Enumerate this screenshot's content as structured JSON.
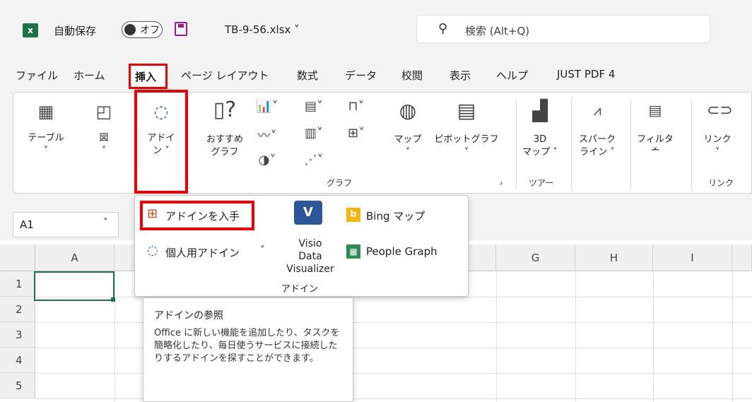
{
  "titlebar": {
    "autosave_label": "自動保存",
    "toggle_text": "オフ",
    "filename": "TB-9-56.xlsx ˅",
    "search_placeholder": "検索 (Alt+Q)"
  },
  "tabs": [
    "ファイル",
    "ホーム",
    "挿入",
    "ページ レイアウト",
    "数式",
    "データ",
    "校閲",
    "表示",
    "ヘルプ",
    "JUST PDF 4"
  ],
  "ribbon": {
    "table": "テーブル",
    "image": "図",
    "addin_1": "アドイ",
    "addin_2": "ン ˅",
    "rec_1": "おすすめ",
    "rec_2": "グラフ",
    "map": "マップ",
    "pivot": "ピボットグラフ",
    "map3d_1": "3D",
    "map3d_2": "マップ ˅",
    "spark_1": "スパーク",
    "spark_2": "ライン ˅",
    "filter": "フィルター",
    "link": "リンク",
    "group_graph": "グラフ",
    "group_tour": "ツアー",
    "group_link": "リンク"
  },
  "namebox": {
    "value": "A1"
  },
  "columns": [
    "A",
    "G",
    "H",
    "I"
  ],
  "rows": [
    "1",
    "2",
    "3",
    "4",
    "5"
  ],
  "dropdown": {
    "get_addin": "アドインを入手",
    "personal_addin": "個人用アドイン",
    "visio_1": "Visio Data",
    "visio_2": "Visualizer",
    "bing": "Bing マップ",
    "people": "People Graph",
    "group_label": "アドイン"
  },
  "tooltip": {
    "title": "アドインの参照",
    "body": "Office に新しい機能を追加したり、タスクを簡略化したり、毎日使うサービスに接続したりするアドインを探すことができます。"
  },
  "colors": {
    "highlight": "#e00000",
    "excel_green": "#1e7145"
  }
}
